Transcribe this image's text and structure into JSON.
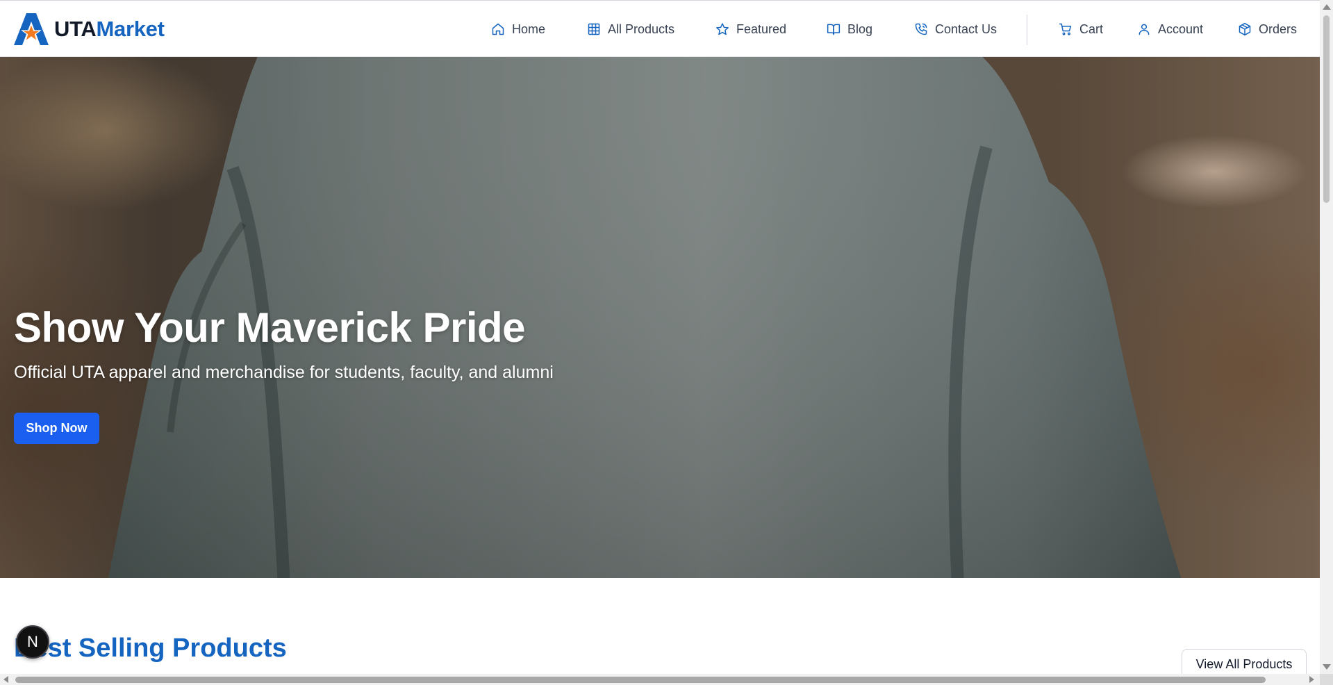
{
  "brand": {
    "name_part1": "UTA",
    "name_part2": "Market"
  },
  "nav": {
    "home": {
      "label": "Home",
      "icon": "home-icon"
    },
    "all_products": {
      "label": "All Products",
      "icon": "grid-icon"
    },
    "featured": {
      "label": "Featured",
      "icon": "star-icon"
    },
    "blog": {
      "label": "Blog",
      "icon": "book-icon"
    },
    "contact": {
      "label": "Contact Us",
      "icon": "phone-icon"
    },
    "cart": {
      "label": "Cart",
      "icon": "cart-icon"
    },
    "account": {
      "label": "Account",
      "icon": "user-icon"
    },
    "orders": {
      "label": "Orders",
      "icon": "package-icon"
    }
  },
  "hero": {
    "title": "Show Your Maverick Pride",
    "subtitle": "Official UTA apparel and merchandise for students, faculty, and alumni",
    "cta_label": "Shop Now"
  },
  "best_selling": {
    "title": "Best Selling Products",
    "view_all_label": "View All Products"
  },
  "floating_badge": {
    "letter": "N"
  },
  "colors": {
    "brand_blue": "#1565c0",
    "cta_blue": "#1a5ff0",
    "text_dark": "#111827"
  }
}
